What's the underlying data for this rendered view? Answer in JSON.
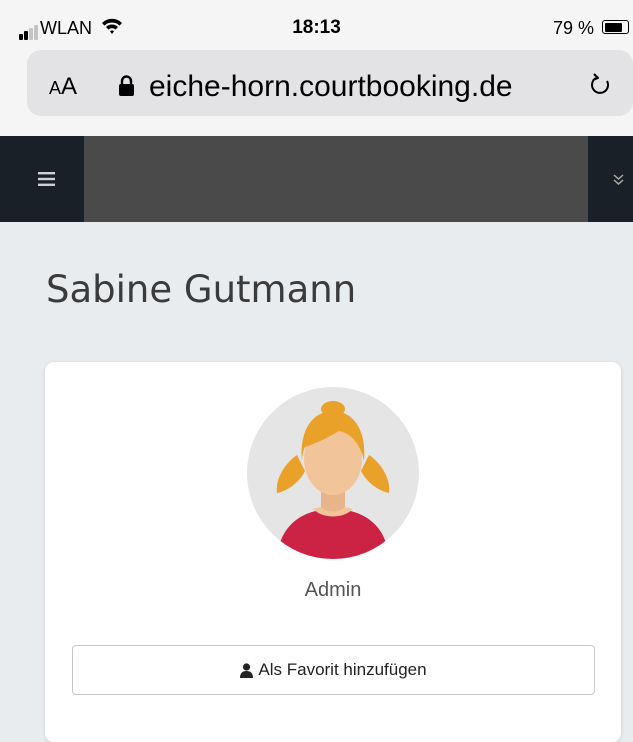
{
  "status_bar": {
    "carrier": "WLAN",
    "time": "18:13",
    "battery_percent": "79 %",
    "battery_level": 0.79,
    "signal_bars_active": 2
  },
  "browser": {
    "text_size_label_small": "A",
    "text_size_label_large": "A",
    "url": "eiche-horn.courtbooking.de",
    "icons": [
      "lock-icon",
      "reload-icon"
    ]
  },
  "navbar": {
    "icons": [
      "hamburger-menu-icon",
      "double-chevron-down-icon"
    ]
  },
  "profile": {
    "name": "Sabine Gutmann",
    "role": "Admin",
    "favorite_button_label": "Als Favorit hinzufügen",
    "favorite_button_icon": "user-icon"
  },
  "colors": {
    "navbar_dark": "#1a2028",
    "navbar": "#4a4a4a",
    "page_background": "#e9ecef",
    "avatar_hair": "#e9a12a",
    "avatar_shirt": "#cc2244",
    "avatar_skin": "#f2c49a"
  }
}
